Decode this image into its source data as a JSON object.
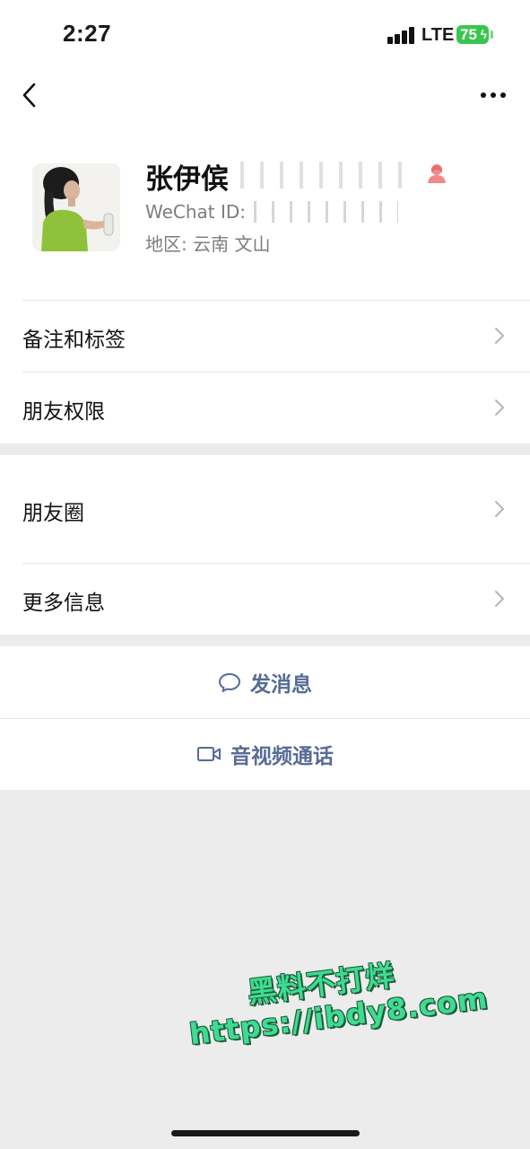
{
  "status_bar": {
    "time": "2:27",
    "network": "LTE",
    "battery": "75"
  },
  "profile": {
    "name": "张伊傧",
    "wechat_id_label": "WeChat ID:",
    "region_label": "地区:",
    "region_value": "云南 文山"
  },
  "menu": {
    "remark_tags": "备注和标签",
    "friend_permissions": "朋友权限",
    "moments": "朋友圈",
    "more_info": "更多信息"
  },
  "actions": {
    "send_message": "发消息",
    "video_call": "音视频通话"
  },
  "watermark": {
    "line1": "黑料不打烊",
    "line2": "https://ibdy8.com"
  },
  "colors": {
    "link_blue": "#576b95",
    "battery_green": "#3ac64e",
    "watermark_green": "#3fdb92"
  }
}
